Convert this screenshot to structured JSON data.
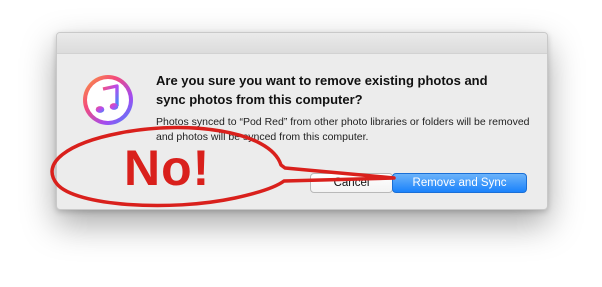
{
  "dialog": {
    "headline": "Are you sure you want to remove existing photos and sync photos from this computer?",
    "body": "Photos synced to “Pod Red” from other photo libraries or folders will be removed and photos will be synced from this computer.",
    "app_icon": "itunes-music-note-icon",
    "buttons": {
      "cancel_label": "Cancel",
      "confirm_label": "Remove and Sync"
    }
  },
  "annotation": {
    "text": "No!",
    "color": "#d9201c"
  },
  "colors": {
    "primary_button": "#1a82fb",
    "dialog_bg": "#ececec"
  }
}
